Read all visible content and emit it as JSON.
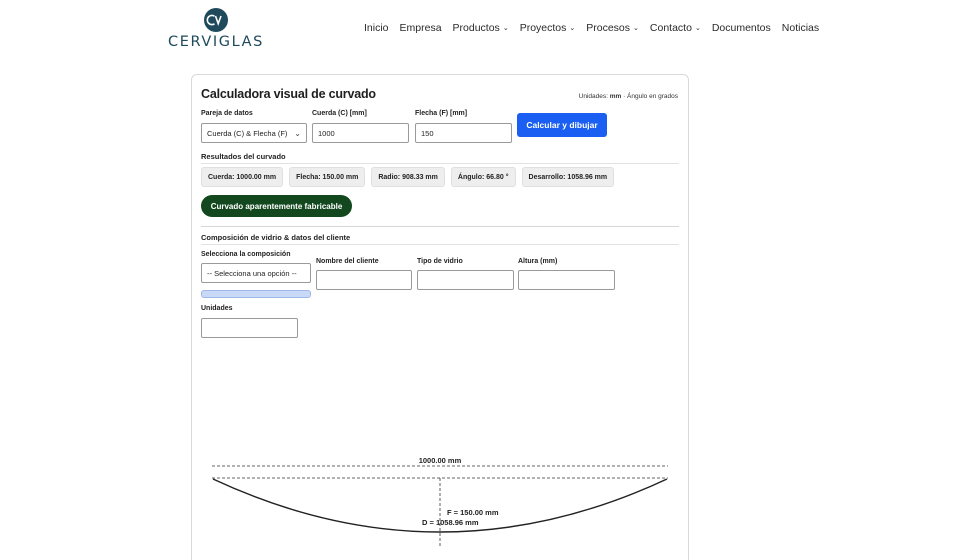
{
  "brand": {
    "name": "CERVIGLAS",
    "icon": "cv-logo-icon",
    "color": "#1f4a5c"
  },
  "nav": {
    "items": [
      {
        "label": "Inicio",
        "dropdown": false
      },
      {
        "label": "Empresa",
        "dropdown": false
      },
      {
        "label": "Productos",
        "dropdown": true
      },
      {
        "label": "Proyectos",
        "dropdown": true
      },
      {
        "label": "Procesos",
        "dropdown": true
      },
      {
        "label": "Contacto",
        "dropdown": true
      },
      {
        "label": "Documentos",
        "dropdown": false
      },
      {
        "label": "Noticias",
        "dropdown": false
      }
    ]
  },
  "calculator": {
    "title": "Calculadora visual de curvado",
    "units_prefix": "Unidades: ",
    "units_value": "mm",
    "units_suffix": " · Ángulo en grados",
    "pair_label": "Pareja de datos",
    "pair_value": "Cuerda (C) & Flecha (F)",
    "chord_label": "Cuerda (C) [mm]",
    "chord_value": "1000",
    "sag_label": "Flecha (F) [mm]",
    "sag_value": "150",
    "calc_button": "Calcular y dibujar",
    "accent_color": "#1a5ff2"
  },
  "results": {
    "title": "Resultados del curvado",
    "chord": "Cuerda: 1000.00 mm",
    "sag": "Flecha: 150.00 mm",
    "radius": "Radio: 908.33 mm",
    "angle": "Ángulo: 66.80 °",
    "development": "Desarrollo: 1058.96 mm",
    "status": "Curvado aparentemente fabricable",
    "status_color": "#13481f"
  },
  "composition": {
    "title": "Composición de vidrio & datos del cliente",
    "select_label": "Selecciona la composición",
    "select_value": "-- Selecciona una opción --",
    "client_label": "Nombre del cliente",
    "client_value": "",
    "glass_type_label": "Tipo de vidrio",
    "glass_type_value": "",
    "height_label": "Altura (mm)",
    "height_value": "",
    "units_label": "Unidades",
    "units_value": ""
  },
  "drawing": {
    "chord_label": "1000.00 mm",
    "sag_label": "F = 150.00 mm",
    "dev_label": "D = 1058.96 mm"
  }
}
